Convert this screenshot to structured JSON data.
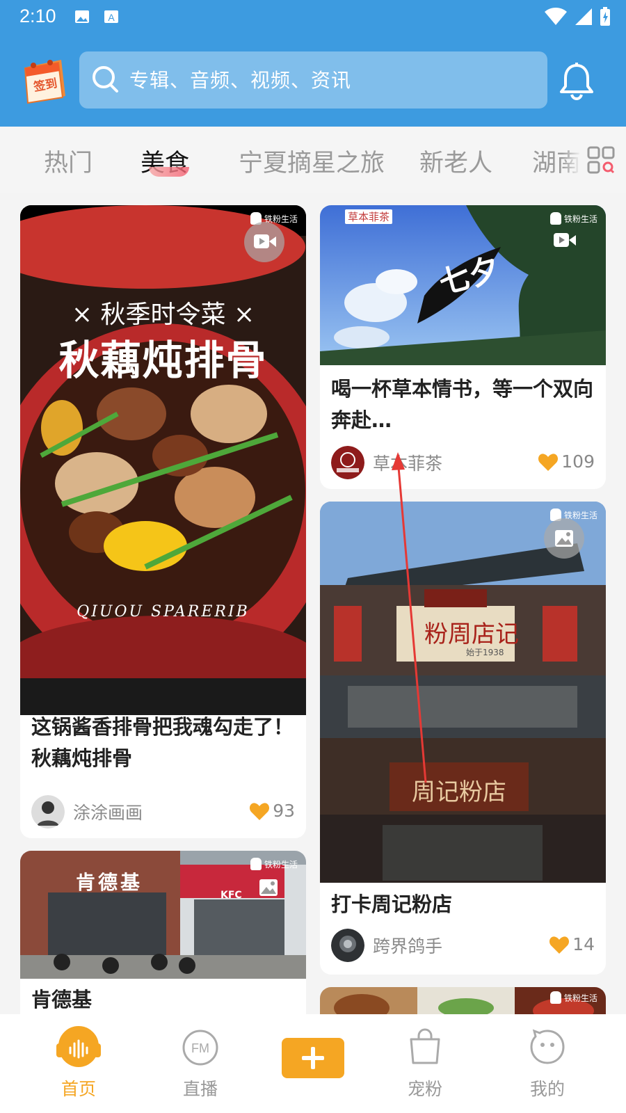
{
  "status_bar": {
    "time": "2:10"
  },
  "header": {
    "signin_label": "签到",
    "search_placeholder": "专辑、音频、视频、资讯"
  },
  "tabs": [
    {
      "label": "热门",
      "active": false
    },
    {
      "label": "美食",
      "active": true
    },
    {
      "label": "宁夏摘星之旅",
      "active": false
    },
    {
      "label": "新老人",
      "active": false
    },
    {
      "label": "湖南",
      "active": false
    }
  ],
  "brand_watermark": "铁粉生活",
  "feed": {
    "card1": {
      "image_lines": [
        "× 秋季时令菜 ×",
        "秋藕炖排骨",
        "QIUOU SPARERIB"
      ],
      "title": "这锅酱香排骨把我魂勾走了！秋藕炖排骨",
      "author": "涂涂画画",
      "likes": "93"
    },
    "card2": {
      "image_lines": [
        "草本菲茶",
        "七夕"
      ],
      "title": "喝一杯草本情书，等一个双向奔赴…",
      "author": "草本菲茶",
      "likes": "109"
    },
    "card3": {
      "image_lines": [
        "周记粉店",
        "粉周店记",
        "始于1938"
      ],
      "title": "打卡周记粉店",
      "author": "跨界鸽手",
      "likes": "14"
    },
    "card4": {
      "image_lines": [
        "肯德基",
        "KFC"
      ],
      "title": "肯德基"
    }
  },
  "bottom_nav": [
    {
      "label": "首页",
      "active": true
    },
    {
      "label": "直播",
      "active": false
    },
    {
      "label": "",
      "active": false
    },
    {
      "label": "宠粉",
      "active": false
    },
    {
      "label": "我的",
      "active": false
    }
  ],
  "colors": {
    "header_blue": "#3d9be0",
    "accent_orange": "#f5a623",
    "tab_underline": "#f45c6e"
  }
}
